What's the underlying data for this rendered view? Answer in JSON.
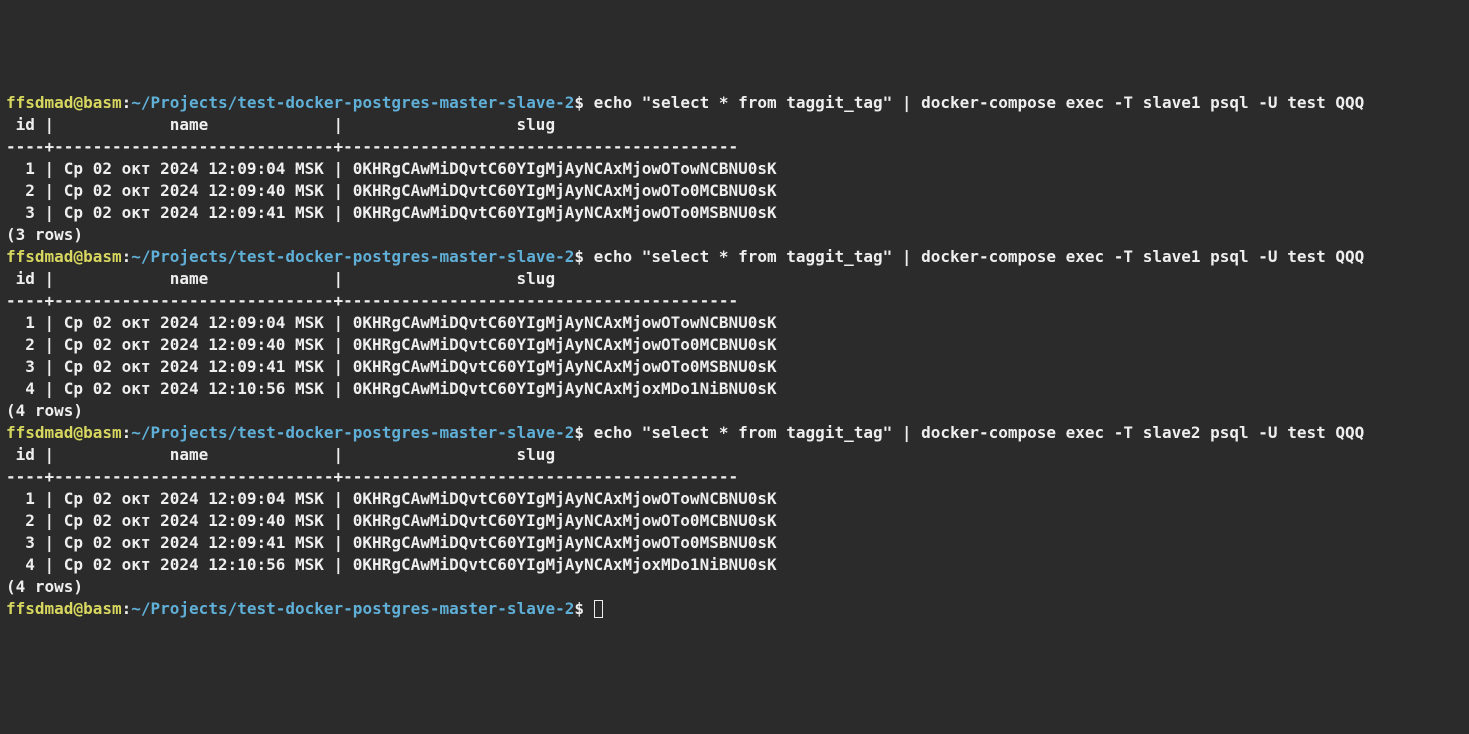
{
  "prompt": {
    "user": "ffsdmad",
    "at": "@",
    "host": "basm",
    "colon": ":",
    "path": "~/Projects/test-docker-postgres-master-slave-2",
    "dollar": "$"
  },
  "queries": [
    {
      "command": "echo \"select * from taggit_tag\" | docker-compose exec -T slave1 psql -U test QQQ",
      "header": " id |            name             |                  slug                   ",
      "divider": "----+-----------------------------+-----------------------------------------",
      "rows": [
        "  1 | Ср 02 окт 2024 12:09:04 MSK | 0KHRgCAwMiDQvtC60YIgMjAyNCAxMjowOTowNCBNU0sK",
        "  2 | Ср 02 окт 2024 12:09:40 MSK | 0KHRgCAwMiDQvtC60YIgMjAyNCAxMjowOTo0MCBNU0sK",
        "  3 | Ср 02 окт 2024 12:09:41 MSK | 0KHRgCAwMiDQvtC60YIgMjAyNCAxMjowOTo0MSBNU0sK"
      ],
      "footer": "(3 rows)"
    },
    {
      "command": "echo \"select * from taggit_tag\" | docker-compose exec -T slave1 psql -U test QQQ",
      "header": " id |            name             |                  slug                   ",
      "divider": "----+-----------------------------+-----------------------------------------",
      "rows": [
        "  1 | Ср 02 окт 2024 12:09:04 MSK | 0KHRgCAwMiDQvtC60YIgMjAyNCAxMjowOTowNCBNU0sK",
        "  2 | Ср 02 окт 2024 12:09:40 MSK | 0KHRgCAwMiDQvtC60YIgMjAyNCAxMjowOTo0MCBNU0sK",
        "  3 | Ср 02 окт 2024 12:09:41 MSK | 0KHRgCAwMiDQvtC60YIgMjAyNCAxMjowOTo0MSBNU0sK",
        "  4 | Ср 02 окт 2024 12:10:56 MSK | 0KHRgCAwMiDQvtC60YIgMjAyNCAxMjoxMDo1NiBNU0sK"
      ],
      "footer": "(4 rows)"
    },
    {
      "command": "echo \"select * from taggit_tag\" | docker-compose exec -T slave2 psql -U test QQQ",
      "header": " id |            name             |                  slug                   ",
      "divider": "----+-----------------------------+-----------------------------------------",
      "rows": [
        "  1 | Ср 02 окт 2024 12:09:04 MSK | 0KHRgCAwMiDQvtC60YIgMjAyNCAxMjowOTowNCBNU0sK",
        "  2 | Ср 02 окт 2024 12:09:40 MSK | 0KHRgCAwMiDQvtC60YIgMjAyNCAxMjowOTo0MCBNU0sK",
        "  3 | Ср 02 окт 2024 12:09:41 MSK | 0KHRgCAwMiDQvtC60YIgMjAyNCAxMjowOTo0MSBNU0sK",
        "  4 | Ср 02 окт 2024 12:10:56 MSK | 0KHRgCAwMiDQvtC60YIgMjAyNCAxMjoxMDo1NiBNU0sK"
      ],
      "footer": "(4 rows)"
    }
  ]
}
